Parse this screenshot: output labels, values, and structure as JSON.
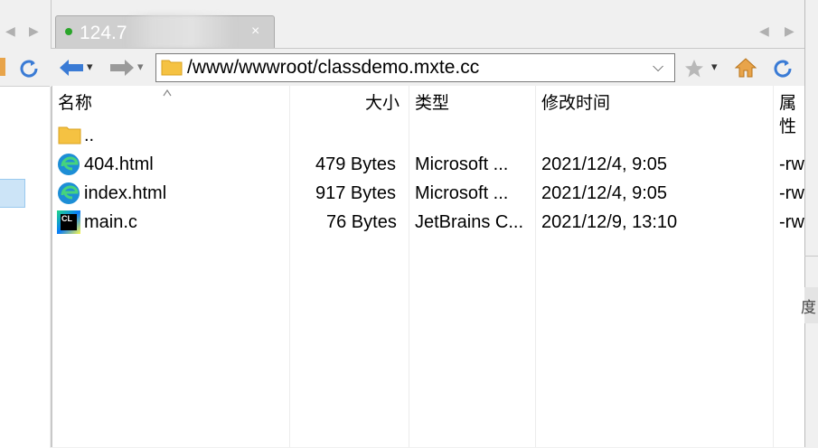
{
  "tab": {
    "title": "124.7",
    "close": "×"
  },
  "nav": {
    "left_arrow": "◀",
    "right_arrow": "▶",
    "caret": "▾"
  },
  "path": {
    "value": "/www/wwwroot/classdemo.mxte.cc",
    "dropdown": "⌵"
  },
  "columns": [
    {
      "label": "名称"
    },
    {
      "label": "大小"
    },
    {
      "label": "类型"
    },
    {
      "label": "修改时间"
    },
    {
      "label": "属性"
    }
  ],
  "files": [
    {
      "name": "..",
      "size": "",
      "type": "",
      "modified": "",
      "attr": "",
      "icon": "folder-icon"
    },
    {
      "name": "404.html",
      "size": "479 Bytes",
      "type": "Microsoft ...",
      "modified": "2021/12/4, 9:05",
      "attr": "-rw",
      "icon": "edge-icon"
    },
    {
      "name": "index.html",
      "size": "917 Bytes",
      "type": "Microsoft ...",
      "modified": "2021/12/4, 9:05",
      "attr": "-rw",
      "icon": "edge-icon"
    },
    {
      "name": "main.c",
      "size": "76 Bytes",
      "type": "JetBrains C...",
      "modified": "2021/12/9, 13:10",
      "attr": "-rw",
      "icon": "clion-icon"
    }
  ],
  "clion_label": "CL",
  "right_fragment": "度",
  "colors": {
    "selection": "#cce4f7",
    "tab_bg": "#cfcfcf",
    "status_dot": "#2aa52a",
    "arrow_blue": "#3a7bd5",
    "folder": "#f5c242"
  }
}
